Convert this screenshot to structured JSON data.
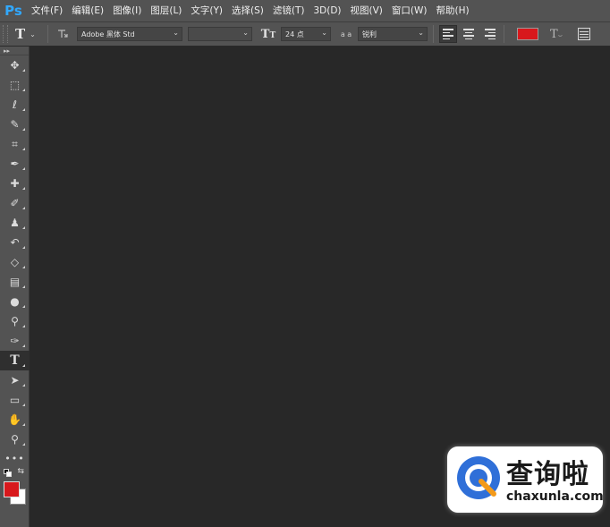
{
  "app": {
    "logo": "Ps"
  },
  "menu": [
    "文件(F)",
    "编辑(E)",
    "图像(I)",
    "图层(L)",
    "文字(Y)",
    "选择(S)",
    "滤镜(T)",
    "3D(D)",
    "视图(V)",
    "窗口(W)",
    "帮助(H)"
  ],
  "options": {
    "tool_preset_icon": "text-tool-icon",
    "font_family": "Adobe 黑体 Std",
    "font_style": "",
    "font_size": "24 点",
    "antialias_label": "a a",
    "antialias": "锐利",
    "text_color": "#d8181c"
  },
  "toolbar": {
    "tools": [
      {
        "name": "move-tool",
        "glyph": "✥",
        "active": false
      },
      {
        "name": "rectangular-marquee-tool",
        "glyph": "⬚",
        "active": false
      },
      {
        "name": "lasso-tool",
        "glyph": "ℓ",
        "active": false
      },
      {
        "name": "quick-selection-tool",
        "glyph": "✎",
        "active": false
      },
      {
        "name": "crop-tool",
        "glyph": "⌗",
        "active": false
      },
      {
        "name": "eyedropper-tool",
        "glyph": "✒",
        "active": false
      },
      {
        "name": "healing-brush-tool",
        "glyph": "✚",
        "active": false
      },
      {
        "name": "brush-tool",
        "glyph": "✐",
        "active": false
      },
      {
        "name": "clone-stamp-tool",
        "glyph": "♟",
        "active": false
      },
      {
        "name": "history-brush-tool",
        "glyph": "↶",
        "active": false
      },
      {
        "name": "eraser-tool",
        "glyph": "◇",
        "active": false
      },
      {
        "name": "gradient-tool",
        "glyph": "▤",
        "active": false
      },
      {
        "name": "blur-tool",
        "glyph": "●",
        "active": false
      },
      {
        "name": "dodge-tool",
        "glyph": "⚲",
        "active": false
      },
      {
        "name": "pen-tool",
        "glyph": "✑",
        "active": false
      },
      {
        "name": "type-tool",
        "glyph": "T",
        "active": true
      },
      {
        "name": "path-selection-tool",
        "glyph": "➤",
        "active": false
      },
      {
        "name": "rectangle-tool",
        "glyph": "▭",
        "active": false
      },
      {
        "name": "hand-tool",
        "glyph": "✋",
        "active": false
      },
      {
        "name": "zoom-tool",
        "glyph": "⚲",
        "active": false
      }
    ],
    "more": "•••",
    "foreground_color": "#d8181c",
    "background_color": "#ffffff"
  },
  "watermark": {
    "name": "查询啦",
    "url": "chaxunla.com"
  }
}
